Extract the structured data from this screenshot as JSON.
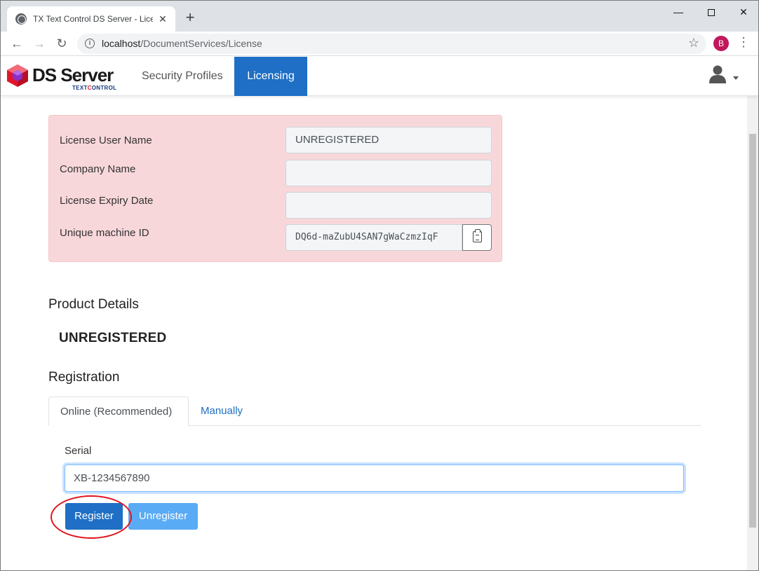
{
  "browser": {
    "tab_title": "TX Text Control DS Server - Licen",
    "new_tab_symbol": "+",
    "url_host": "localhost",
    "url_path": "/DocumentServices/License",
    "profile_initial": "B"
  },
  "navbar": {
    "brand_name": "DS Server",
    "brand_sub_text": "TEXT",
    "brand_sub_accent": "C",
    "brand_sub_rest": "ONTROL",
    "items": [
      {
        "label": "Security Profiles",
        "active": false
      },
      {
        "label": "Licensing",
        "active": true
      }
    ]
  },
  "license": {
    "fields": [
      {
        "label": "License User Name",
        "value": "UNREGISTERED"
      },
      {
        "label": "Company Name",
        "value": ""
      },
      {
        "label": "License Expiry Date",
        "value": ""
      },
      {
        "label": "Unique machine ID",
        "value": "DQ6d-maZubU4SAN7gWaCzmzIqF"
      }
    ]
  },
  "product_details": {
    "heading": "Product Details",
    "product": "UNREGISTERED"
  },
  "registration": {
    "heading": "Registration",
    "tabs": [
      {
        "label": "Online (Recommended)",
        "active": true
      },
      {
        "label": "Manually",
        "active": false
      }
    ],
    "serial_label": "Serial",
    "serial_value": "XB-1234567890",
    "register_button": "Register",
    "unregister_button": "Unregister"
  },
  "colors": {
    "primary": "#1e6fc5",
    "primary_light": "#5aabf5",
    "alert_bg": "#f8d7da",
    "highlight": "#e0141b"
  }
}
